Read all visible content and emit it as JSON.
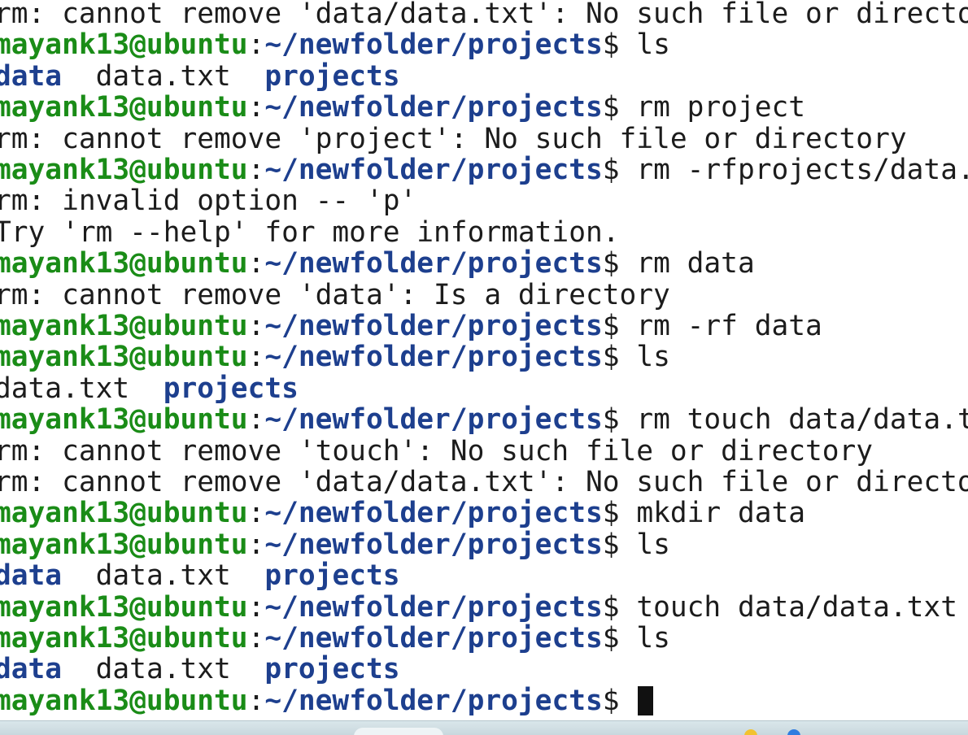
{
  "terminal": {
    "prompt_user": "mayank13@ubuntu",
    "prompt_path": "~/newfolder/projects",
    "prompt_symbol": "$",
    "lines": [
      {
        "type": "output",
        "text": "rm: cannot remove 'data/data.txt': No such file or directo"
      },
      {
        "type": "prompt",
        "cmd": " ls"
      },
      {
        "type": "ls",
        "items": [
          {
            "name": "data",
            "dir": true
          },
          {
            "name": "data.txt",
            "dir": false
          },
          {
            "name": "projects",
            "dir": true
          }
        ]
      },
      {
        "type": "prompt",
        "cmd": " rm project"
      },
      {
        "type": "output",
        "text": "rm: cannot remove 'project': No such file or directory"
      },
      {
        "type": "prompt",
        "cmd": " rm -rfprojects/data."
      },
      {
        "type": "output",
        "text": "rm: invalid option -- 'p'"
      },
      {
        "type": "output",
        "text": "Try 'rm --help' for more information."
      },
      {
        "type": "prompt",
        "cmd": " rm data"
      },
      {
        "type": "output",
        "text": "rm: cannot remove 'data': Is a directory"
      },
      {
        "type": "prompt",
        "cmd": " rm -rf data"
      },
      {
        "type": "prompt",
        "cmd": " ls"
      },
      {
        "type": "ls",
        "items": [
          {
            "name": "data.txt",
            "dir": false
          },
          {
            "name": "projects",
            "dir": true
          }
        ]
      },
      {
        "type": "prompt",
        "cmd": " rm touch data/data.t"
      },
      {
        "type": "output",
        "text": "rm: cannot remove 'touch': No such file or directory"
      },
      {
        "type": "output",
        "text": "rm: cannot remove 'data/data.txt': No such file or directo"
      },
      {
        "type": "prompt",
        "cmd": " mkdir data"
      },
      {
        "type": "prompt",
        "cmd": " ls"
      },
      {
        "type": "ls",
        "items": [
          {
            "name": "data",
            "dir": true
          },
          {
            "name": "data.txt",
            "dir": false
          },
          {
            "name": "projects",
            "dir": true
          }
        ]
      },
      {
        "type": "prompt",
        "cmd": " touch data/data.txt"
      },
      {
        "type": "prompt",
        "cmd": " ls"
      },
      {
        "type": "ls",
        "items": [
          {
            "name": "data",
            "dir": true
          },
          {
            "name": "data.txt",
            "dir": false
          },
          {
            "name": "projects",
            "dir": true
          }
        ]
      },
      {
        "type": "prompt",
        "cmd": " ",
        "cursor": true
      }
    ]
  },
  "taskbar": {
    "icon_colors": [
      "#f2c230",
      "#2f7de0"
    ]
  },
  "colors": {
    "user": "#1a8c17",
    "path": "#1d3f8e",
    "text": "#1c1c1c",
    "background": "#ffffff"
  }
}
